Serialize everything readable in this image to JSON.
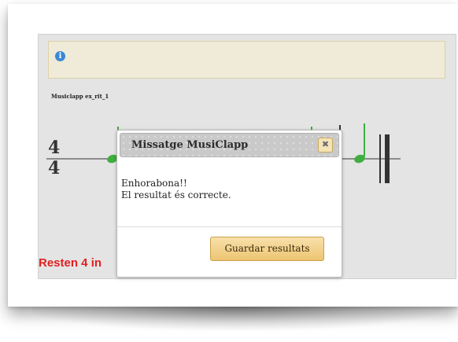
{
  "info": {
    "icon": "info-circle-icon",
    "symbol": "i"
  },
  "exercise": {
    "label": "Musiclapp ex_rit_1"
  },
  "staff": {
    "time_signature_top": "4",
    "time_signature_bottom": "4"
  },
  "status": {
    "remaining_text": "Resten 4 in"
  },
  "dialog": {
    "title": "Missatge MusiClapp",
    "close_symbol": "✖",
    "message_line1": "Enhorabona!!",
    "message_line2": "El resultat és correcte.",
    "save_label": "Guardar resultats"
  },
  "colors": {
    "note_green": "#3fae3f",
    "alert_red": "#e02020",
    "info_blue": "#3a87d6"
  }
}
